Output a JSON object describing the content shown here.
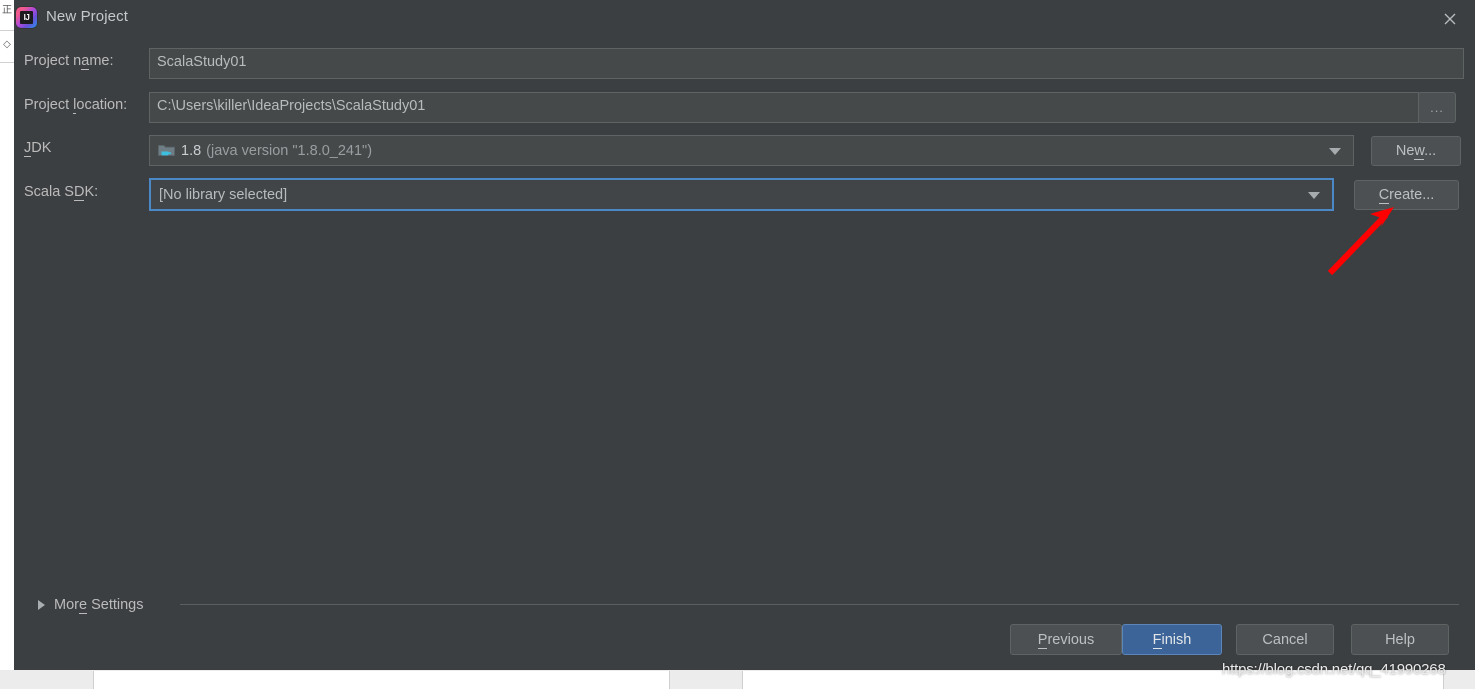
{
  "window": {
    "title": "New Project",
    "app_icon": "intellij-idea-icon",
    "icon_text": "IJ",
    "close_icon": "close-icon"
  },
  "form": {
    "fields": [
      {
        "id": "project-name",
        "label_pre": "Project n",
        "label_mnemonic": "a",
        "label_post": "me:",
        "value": "ScalaStudy01",
        "type": "text"
      },
      {
        "id": "project-location",
        "label_pre": "Project ",
        "label_mnemonic": "l",
        "label_post": "ocation:",
        "value": "C:\\Users\\killer\\IdeaProjects\\ScalaStudy01",
        "type": "text"
      },
      {
        "id": "jdk",
        "label_pre": "",
        "label_mnemonic": "J",
        "label_post": "DK",
        "value_strong": "1.8",
        "value_dim": "(java version \"1.8.0_241\")",
        "type": "combo",
        "icon": "jdk-folder-icon",
        "focused": false
      },
      {
        "id": "scala-sdk",
        "label_pre": "Scala S",
        "label_mnemonic": "D",
        "label_post": "K:",
        "value": "[No library selected]",
        "type": "combo",
        "focused": true
      }
    ],
    "browse_button": "...",
    "jdk_new_button": {
      "pre": "Ne",
      "mnemonic": "w",
      "post": "..."
    },
    "scala_create_button": {
      "pre": "",
      "mnemonic": "C",
      "post": "reate..."
    }
  },
  "more_settings": {
    "label_pre": "Mor",
    "label_mnemonic": "e",
    "label_post": " Settings",
    "expanded": false,
    "toggle_icon": "triangle-right-icon"
  },
  "footer": {
    "buttons": [
      {
        "id": "previous",
        "pre": "",
        "mnemonic": "P",
        "post": "revious",
        "primary": false
      },
      {
        "id": "finish",
        "pre": "",
        "mnemonic": "F",
        "post": "inish",
        "primary": true
      },
      {
        "id": "cancel",
        "pre": "Cancel",
        "mnemonic": "",
        "post": "",
        "primary": false
      },
      {
        "id": "help",
        "pre": "Help",
        "mnemonic": "",
        "post": "",
        "primary": false
      }
    ]
  },
  "annotation": {
    "arrow_color": "#fe0000",
    "arrow_name": "red-pointer-arrow"
  },
  "watermark": {
    "text": "https://blog.csdn.net/qq_41990268"
  },
  "colors": {
    "dialog_bg": "#3c3f41",
    "field_bg": "#45494a",
    "focus_border": "#4a88c7",
    "primary_button": "#3c6498",
    "text": "#bbbbbb"
  }
}
